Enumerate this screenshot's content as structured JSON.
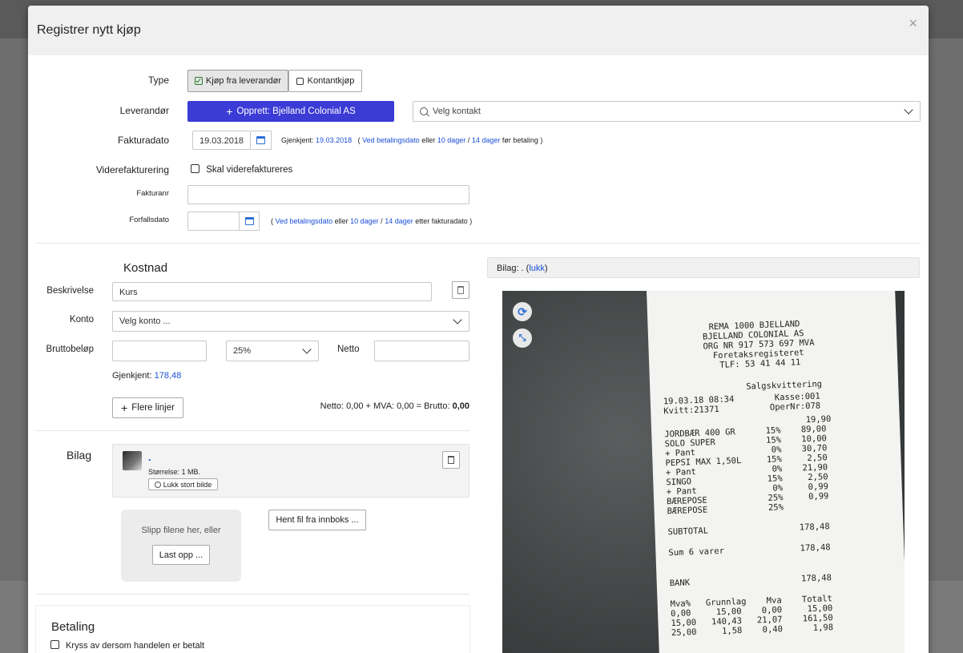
{
  "modal": {
    "title": "Registrer nytt kjøp",
    "close": "×"
  },
  "type": {
    "label": "Type",
    "option_supplier": "Kjøp fra leverandør",
    "option_cash": "Kontantkjøp"
  },
  "supplier": {
    "label": "Leverandør",
    "create_button": "Opprett: Bjelland Colonial AS",
    "contact_placeholder": "Velg kontakt"
  },
  "invoice_date": {
    "label": "Fakturadato",
    "value": "19.03.2018",
    "recognized_prefix": "Gjenkjent:",
    "recognized_value": "19.03.2018",
    "paren_open": "(",
    "on_payment": "Ved betalingsdato",
    "or": "eller",
    "ten_days": "10 dager",
    "slash": "/",
    "fourteen_days": "14 dager",
    "suffix": "før betaling )"
  },
  "rebilling": {
    "label": "Viderefakturering",
    "checkbox": "Skal viderefaktureres"
  },
  "invoice_no": {
    "label": "Fakturanr",
    "value": ""
  },
  "due_date": {
    "label": "Forfallsdato",
    "value": "",
    "paren_open": "(",
    "on_payment": "Ved betalingsdato",
    "or": "eller",
    "ten_days": "10 dager",
    "slash": "/",
    "fourteen_days": "14 dager",
    "suffix": "etter fakturadato )"
  },
  "cost": {
    "heading": "Kostnad",
    "desc_label": "Beskrivelse",
    "desc_value": "Kurs",
    "account_label": "Konto",
    "account_placeholder": "Velg konto ...",
    "gross_label": "Bruttobeløp",
    "gross_value": "",
    "vat_value": "25%",
    "net_label": "Netto",
    "net_value": "",
    "recognized_prefix": "Gjenkjent:",
    "recognized_value": "178,48",
    "more_lines": "Flere linjer",
    "summary": "Netto: 0,00 + MVA: 0,00 = Brutto:",
    "summary_total": "0,00"
  },
  "attachment": {
    "heading": "Bilag",
    "file_name": ".",
    "size": "Størrelse: 1 MB.",
    "close_big": "Lukk stort bilde",
    "drop_text": "Slipp filene her, eller",
    "upload": "Last opp ...",
    "inbox": "Hent fil fra innboks ..."
  },
  "payment": {
    "heading": "Betaling",
    "checkbox": "Kryss av dersom handelen er betalt"
  },
  "preview": {
    "label": "Bilag: . (",
    "close_link": "lukk",
    "label_end": ")"
  },
  "receipt": {
    "lines": [
      "REMA 1000 BJELLAND",
      "BJELLAND COLONIAL AS",
      "ORG NR 917 573 697 MVA",
      "Foretaksregisteret",
      "TLF: 53 41 44 11",
      "Salgskvittering",
      "19.03.18 08:34        Kasse:001",
      "Kvitt:21371          OperNr:078",
      "                            19,90",
      "JORDBÆR 400 GR      15%    89,00",
      "SOLO SUPER          15%    10,00",
      "+ Pant               0%    30,70",
      "PEPSI MAX 1,50L     15%     2,50",
      "+ Pant               0%    21,90",
      "SINGO               15%     2,50",
      "+ Pant               0%     0,99",
      "BÆREPOSE            25%     0,99",
      "BÆREPOSE            25%",
      "SUBTOTAL                  178,48",
      "Sum 6 varer               178,48",
      "BANK                      178,48",
      "Mva%   Grunnlag    Mva    Totalt",
      "0,00     15,00    0,00     15,00",
      "15,00   140,43   21,07    161,50",
      "25,00     1,58    0,40      1,98"
    ]
  },
  "colors": {
    "primary": "#3b3bd6",
    "link": "#1a4fd6"
  }
}
